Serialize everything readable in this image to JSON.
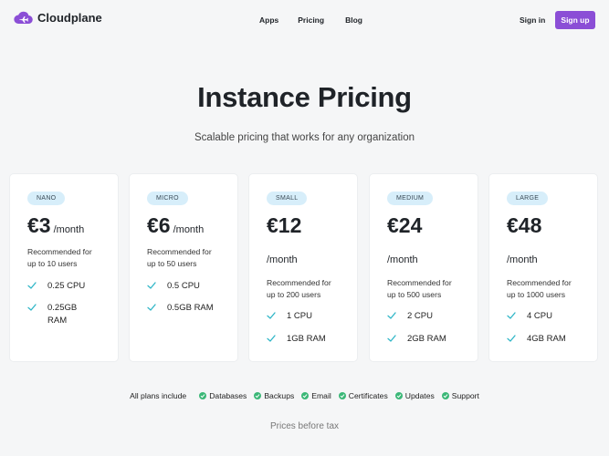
{
  "brand": {
    "name": "Cloudplane",
    "accent": "#8b4ed6"
  },
  "nav": {
    "links": [
      "Apps",
      "Pricing",
      "Blog"
    ],
    "signin": "Sign in",
    "signup": "Sign up"
  },
  "hero": {
    "title": "Instance Pricing",
    "subtitle": "Scalable pricing that works for any organization"
  },
  "plans": [
    {
      "badge": "NANO",
      "price": "€3",
      "period": "/month",
      "rec": [
        "Recommended for",
        "up to 10 users"
      ],
      "features": [
        "0.25 CPU",
        "0.25GB RAM"
      ]
    },
    {
      "badge": "MICRO",
      "price": "€6",
      "period": "/month",
      "rec": [
        "Recommended for",
        "up to 50 users"
      ],
      "features": [
        "0.5 CPU",
        "0.5GB RAM"
      ]
    },
    {
      "badge": "SMALL",
      "price": "€12",
      "period": "/month",
      "rec": [
        "Recommended for",
        "up to 200 users"
      ],
      "features": [
        "1 CPU",
        "1GB RAM"
      ]
    },
    {
      "badge": "MEDIUM",
      "price": "€24",
      "period": "/month",
      "rec": [
        "Recommended for",
        "up to 500 users"
      ],
      "features": [
        "2 CPU",
        "2GB RAM"
      ]
    },
    {
      "badge": "LARGE",
      "price": "€48",
      "period": "/month",
      "rec": [
        "Recommended for",
        "up to 1000 users"
      ],
      "features": [
        "4 CPU",
        "4GB RAM"
      ]
    }
  ],
  "included": {
    "label": "All plans include",
    "items": [
      "Databases",
      "Backups",
      "Email",
      "Certificates",
      "Updates",
      "Support"
    ]
  },
  "footnote": "Prices before tax",
  "colors": {
    "check": "#2fb6c7",
    "included_dot": "#3cb878",
    "badge_bg": "#d7eefa"
  }
}
